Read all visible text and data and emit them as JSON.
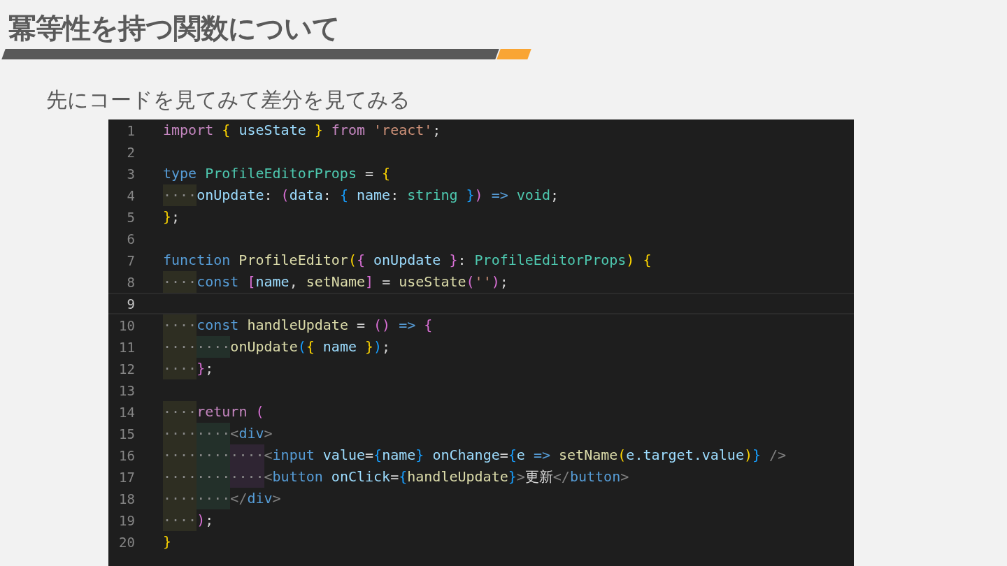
{
  "title": "冪等性を持つ関数について",
  "subtitle": "先にコードを見てみて差分を見てみる",
  "editor": {
    "lines": [
      {
        "number": "1",
        "current": false,
        "tokens": [
          {
            "kind": "keyword",
            "text": "import"
          },
          {
            "kind": "brace1",
            "text": " {"
          },
          {
            "kind": "variable",
            "text": " useState "
          },
          {
            "kind": "brace1",
            "text": "}"
          },
          {
            "kind": "keyword",
            "text": " from"
          },
          {
            "kind": "string",
            "text": " 'react'"
          },
          {
            "kind": "plain",
            "text": ";"
          }
        ]
      },
      {
        "number": "2",
        "current": false
      },
      {
        "number": "3",
        "current": false,
        "tokens": [
          {
            "kind": "storage",
            "text": "type"
          },
          {
            "kind": "type",
            "text": " ProfileEditorProps"
          },
          {
            "kind": "plain",
            "text": " = "
          },
          {
            "kind": "brace1",
            "text": "{"
          }
        ]
      },
      {
        "number": "4",
        "current": false,
        "tokens": [
          {
            "kind": "indent",
            "text": "····"
          },
          {
            "kind": "variable",
            "text": "onUpdate"
          },
          {
            "kind": "plain",
            "text": ": "
          },
          {
            "kind": "brace2",
            "text": "("
          },
          {
            "kind": "variable",
            "text": "data"
          },
          {
            "kind": "plain",
            "text": ": "
          },
          {
            "kind": "brace3",
            "text": "{"
          },
          {
            "kind": "variable",
            "text": " name"
          },
          {
            "kind": "plain",
            "text": ": "
          },
          {
            "kind": "type",
            "text": "string"
          },
          {
            "kind": "brace3",
            "text": " }"
          },
          {
            "kind": "brace2",
            "text": ")"
          },
          {
            "kind": "storage",
            "text": " =>"
          },
          {
            "kind": "type",
            "text": " void"
          },
          {
            "kind": "plain",
            "text": ";"
          }
        ]
      },
      {
        "number": "5",
        "current": false,
        "tokens": [
          {
            "kind": "brace1",
            "text": "}"
          },
          {
            "kind": "plain",
            "text": ";"
          }
        ]
      },
      {
        "number": "6",
        "current": false
      },
      {
        "number": "7",
        "current": false,
        "tokens": [
          {
            "kind": "storage",
            "text": "function"
          },
          {
            "kind": "function",
            "text": " ProfileEditor"
          },
          {
            "kind": "brace1",
            "text": "("
          },
          {
            "kind": "brace2",
            "text": "{"
          },
          {
            "kind": "variable",
            "text": " onUpdate "
          },
          {
            "kind": "brace2",
            "text": "}"
          },
          {
            "kind": "plain",
            "text": ": "
          },
          {
            "kind": "type",
            "text": "ProfileEditorProps"
          },
          {
            "kind": "brace1",
            "text": ") {"
          }
        ]
      },
      {
        "number": "8",
        "current": false,
        "tokens": [
          {
            "kind": "indent",
            "text": "····"
          },
          {
            "kind": "storage",
            "text": "const"
          },
          {
            "kind": "brace2",
            "text": " ["
          },
          {
            "kind": "variable",
            "text": "name"
          },
          {
            "kind": "plain",
            "text": ", "
          },
          {
            "kind": "function",
            "text": "setName"
          },
          {
            "kind": "brace2",
            "text": "]"
          },
          {
            "kind": "plain",
            "text": " = "
          },
          {
            "kind": "function",
            "text": "useState"
          },
          {
            "kind": "brace2",
            "text": "("
          },
          {
            "kind": "string",
            "text": "''"
          },
          {
            "kind": "brace2",
            "text": ")"
          },
          {
            "kind": "plain",
            "text": ";"
          }
        ]
      },
      {
        "number": "9",
        "current": true
      },
      {
        "number": "10",
        "current": false,
        "tokens": [
          {
            "kind": "indent",
            "text": "····"
          },
          {
            "kind": "storage",
            "text": "const"
          },
          {
            "kind": "function",
            "text": " handleUpdate"
          },
          {
            "kind": "plain",
            "text": " = "
          },
          {
            "kind": "brace2",
            "text": "()"
          },
          {
            "kind": "storage",
            "text": " =>"
          },
          {
            "kind": "brace2",
            "text": " {"
          }
        ]
      },
      {
        "number": "11",
        "current": false,
        "tokens": [
          {
            "kind": "indent",
            "text": "····"
          },
          {
            "kind": "indent",
            "text": "····"
          },
          {
            "kind": "function",
            "text": "onUpdate"
          },
          {
            "kind": "brace3",
            "text": "("
          },
          {
            "kind": "brace1",
            "text": "{"
          },
          {
            "kind": "variable",
            "text": " name "
          },
          {
            "kind": "brace1",
            "text": "}"
          },
          {
            "kind": "brace3",
            "text": ")"
          },
          {
            "kind": "plain",
            "text": ";"
          }
        ]
      },
      {
        "number": "12",
        "current": false,
        "tokens": [
          {
            "kind": "indent",
            "text": "····"
          },
          {
            "kind": "brace2",
            "text": "}"
          },
          {
            "kind": "plain",
            "text": ";"
          }
        ]
      },
      {
        "number": "13",
        "current": false
      },
      {
        "number": "14",
        "current": false,
        "tokens": [
          {
            "kind": "indent",
            "text": "····"
          },
          {
            "kind": "keyword",
            "text": "return"
          },
          {
            "kind": "brace2",
            "text": " ("
          }
        ]
      },
      {
        "number": "15",
        "current": false,
        "tokens": [
          {
            "kind": "indent",
            "text": "····"
          },
          {
            "kind": "indent",
            "text": "····"
          },
          {
            "kind": "tag",
            "text": "<"
          },
          {
            "kind": "tagname",
            "text": "div"
          },
          {
            "kind": "tag",
            "text": ">"
          }
        ]
      },
      {
        "number": "16",
        "current": false,
        "tokens": [
          {
            "kind": "indent",
            "text": "····"
          },
          {
            "kind": "indent",
            "text": "····"
          },
          {
            "kind": "indent",
            "text": "····"
          },
          {
            "kind": "tag",
            "text": "<"
          },
          {
            "kind": "tagname",
            "text": "input"
          },
          {
            "kind": "variable",
            "text": " value"
          },
          {
            "kind": "plain",
            "text": "="
          },
          {
            "kind": "brace3",
            "text": "{"
          },
          {
            "kind": "variable",
            "text": "name"
          },
          {
            "kind": "brace3",
            "text": "}"
          },
          {
            "kind": "variable",
            "text": " onChange"
          },
          {
            "kind": "plain",
            "text": "="
          },
          {
            "kind": "brace3",
            "text": "{"
          },
          {
            "kind": "variable",
            "text": "e"
          },
          {
            "kind": "storage",
            "text": " =>"
          },
          {
            "kind": "function",
            "text": " setName"
          },
          {
            "kind": "brace1",
            "text": "("
          },
          {
            "kind": "variable",
            "text": "e.target.value"
          },
          {
            "kind": "brace1",
            "text": ")"
          },
          {
            "kind": "brace3",
            "text": "}"
          },
          {
            "kind": "tag",
            "text": " />"
          }
        ]
      },
      {
        "number": "17",
        "current": false,
        "tokens": [
          {
            "kind": "indent",
            "text": "····"
          },
          {
            "kind": "indent",
            "text": "····"
          },
          {
            "kind": "indent",
            "text": "····"
          },
          {
            "kind": "tag",
            "text": "<"
          },
          {
            "kind": "tagname",
            "text": "button"
          },
          {
            "kind": "variable",
            "text": " onClick"
          },
          {
            "kind": "plain",
            "text": "="
          },
          {
            "kind": "brace3",
            "text": "{"
          },
          {
            "kind": "function",
            "text": "handleUpdate"
          },
          {
            "kind": "brace3",
            "text": "}"
          },
          {
            "kind": "tag",
            "text": ">"
          },
          {
            "kind": "plain",
            "text": "更新"
          },
          {
            "kind": "tag",
            "text": "</"
          },
          {
            "kind": "tagname",
            "text": "button"
          },
          {
            "kind": "tag",
            "text": ">"
          }
        ]
      },
      {
        "number": "18",
        "current": false,
        "tokens": [
          {
            "kind": "indent",
            "text": "····"
          },
          {
            "kind": "indent",
            "text": "····"
          },
          {
            "kind": "tag",
            "text": "</"
          },
          {
            "kind": "tagname",
            "text": "div"
          },
          {
            "kind": "tag",
            "text": ">"
          }
        ]
      },
      {
        "number": "19",
        "current": false,
        "tokens": [
          {
            "kind": "indent",
            "text": "····"
          },
          {
            "kind": "brace2",
            "text": ")"
          },
          {
            "kind": "plain",
            "text": ";"
          }
        ]
      },
      {
        "number": "20",
        "current": false,
        "tokens": [
          {
            "kind": "brace1",
            "text": "}"
          }
        ]
      }
    ]
  }
}
